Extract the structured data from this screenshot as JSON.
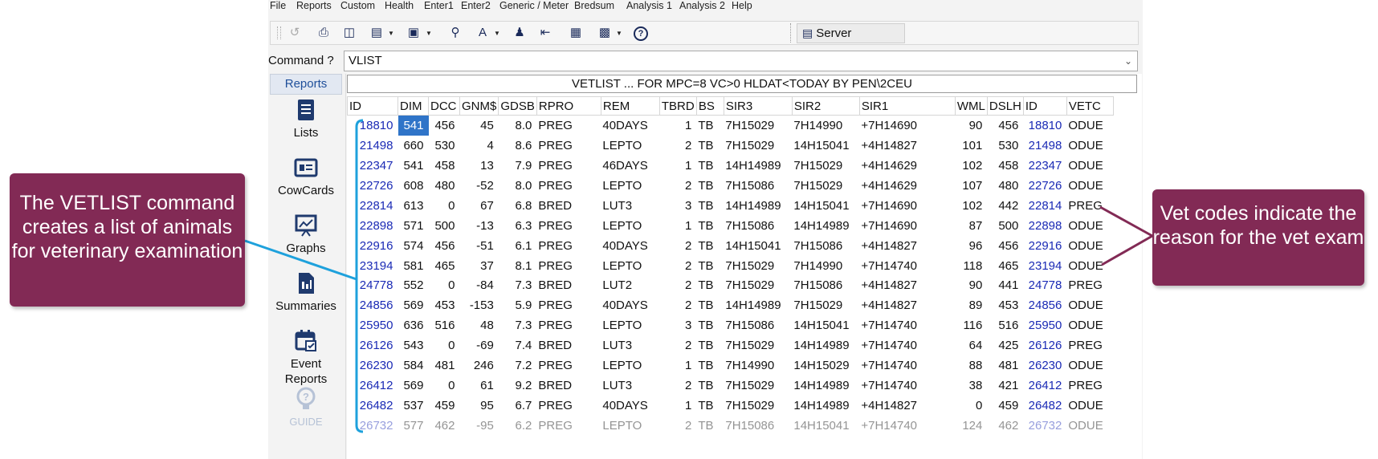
{
  "menu": [
    "File",
    "Reports",
    "Custom",
    "Health",
    "Enter1",
    "Enter2",
    "Generic / Meter",
    "Bredsum",
    "Analysis 1",
    "Analysis 2",
    "Help"
  ],
  "toolbar": {
    "icons": [
      "back-icon",
      "print-icon",
      "print-preview-icon",
      "document-icon",
      "save-icon",
      "search-icon",
      "font-icon",
      "person-icon",
      "export-icon",
      "calendar-icon",
      "card-icon",
      "help-icon"
    ],
    "server_label": "Server"
  },
  "command": {
    "label": "Command ?",
    "value": "VLIST"
  },
  "side_panel": {
    "tab": "Reports",
    "items": [
      {
        "label": "Lists",
        "icon": "list-icon"
      },
      {
        "label": "CowCards",
        "icon": "cowcard-icon"
      },
      {
        "label": "Graphs",
        "icon": "graph-icon"
      },
      {
        "label": "Summaries",
        "icon": "summary-icon"
      },
      {
        "label": "Event\nReports",
        "icon": "event-calendar-icon"
      },
      {
        "label": "GUIDE",
        "icon": "guide-icon"
      }
    ]
  },
  "report": {
    "title": "VETLIST ...  FOR MPC=8 VC>0 HLDAT<TODAY BY PEN\\2CEU",
    "columns": [
      "ID",
      "DIM",
      "DCC",
      "GNM$",
      "GDSB",
      "RPRO",
      "REM",
      "TBRD",
      "BS",
      "SIR3",
      "SIR2",
      "SIR1",
      "WML",
      "DSLH",
      "ID",
      "VETC"
    ],
    "rows": [
      [
        "18810",
        "541",
        "456",
        "45",
        "8.0",
        "PREG",
        "40DAYS",
        "1",
        "TB",
        "7H15029",
        "7H14990",
        "+7H14690",
        "90",
        "456",
        "18810",
        "ODUE"
      ],
      [
        "21498",
        "660",
        "530",
        "4",
        "8.6",
        "PREG",
        "LEPTO",
        "2",
        "TB",
        "7H15029",
        "14H15041",
        "+4H14827",
        "101",
        "530",
        "21498",
        "ODUE"
      ],
      [
        "22347",
        "541",
        "458",
        "13",
        "7.9",
        "PREG",
        "46DAYS",
        "1",
        "TB",
        "14H14989",
        "7H15029",
        "+4H14629",
        "102",
        "458",
        "22347",
        "ODUE"
      ],
      [
        "22726",
        "608",
        "480",
        "-52",
        "8.0",
        "PREG",
        "LEPTO",
        "2",
        "TB",
        "7H15086",
        "7H15029",
        "+4H14629",
        "107",
        "480",
        "22726",
        "ODUE"
      ],
      [
        "22814",
        "613",
        "0",
        "67",
        "6.8",
        "BRED",
        "LUT3",
        "3",
        "TB",
        "14H14989",
        "14H15041",
        "+7H14690",
        "102",
        "442",
        "22814",
        "PREG"
      ],
      [
        "22898",
        "571",
        "500",
        "-13",
        "6.3",
        "PREG",
        "LEPTO",
        "1",
        "TB",
        "7H15086",
        "14H14989",
        "+7H14690",
        "87",
        "500",
        "22898",
        "ODUE"
      ],
      [
        "22916",
        "574",
        "456",
        "-51",
        "6.1",
        "PREG",
        "40DAYS",
        "2",
        "TB",
        "14H15041",
        "7H15086",
        "+4H14827",
        "96",
        "456",
        "22916",
        "ODUE"
      ],
      [
        "23194",
        "581",
        "465",
        "37",
        "8.1",
        "PREG",
        "LEPTO",
        "2",
        "TB",
        "7H15029",
        "7H14990",
        "+7H14740",
        "118",
        "465",
        "23194",
        "ODUE"
      ],
      [
        "24778",
        "552",
        "0",
        "-84",
        "7.3",
        "BRED",
        "LUT2",
        "2",
        "TB",
        "7H15029",
        "7H15086",
        "+4H14827",
        "90",
        "441",
        "24778",
        "PREG"
      ],
      [
        "24856",
        "569",
        "453",
        "-153",
        "5.9",
        "PREG",
        "40DAYS",
        "2",
        "TB",
        "14H14989",
        "7H15029",
        "+4H14827",
        "89",
        "453",
        "24856",
        "ODUE"
      ],
      [
        "25950",
        "636",
        "516",
        "48",
        "7.3",
        "PREG",
        "LEPTO",
        "3",
        "TB",
        "7H15086",
        "14H15041",
        "+7H14740",
        "116",
        "516",
        "25950",
        "ODUE"
      ],
      [
        "26126",
        "543",
        "0",
        "-69",
        "7.4",
        "BRED",
        "LUT3",
        "2",
        "TB",
        "7H15029",
        "14H14989",
        "+7H14740",
        "64",
        "425",
        "26126",
        "PREG"
      ],
      [
        "26230",
        "584",
        "481",
        "246",
        "7.2",
        "PREG",
        "LEPTO",
        "1",
        "TB",
        "7H14990",
        "14H15029",
        "+7H14740",
        "88",
        "481",
        "26230",
        "ODUE"
      ],
      [
        "26412",
        "569",
        "0",
        "61",
        "9.2",
        "BRED",
        "LUT3",
        "2",
        "TB",
        "7H15029",
        "14H14989",
        "+7H14740",
        "38",
        "421",
        "26412",
        "PREG"
      ],
      [
        "26482",
        "537",
        "459",
        "95",
        "6.7",
        "PREG",
        "40DAYS",
        "1",
        "TB",
        "7H15029",
        "14H14989",
        "+4H14827",
        "0",
        "459",
        "26482",
        "ODUE"
      ],
      [
        "26732",
        "577",
        "462",
        "-95",
        "6.2",
        "PREG",
        "LEPTO",
        "2",
        "TB",
        "7H15086",
        "14H15041",
        "+7H14740",
        "124",
        "462",
        "26732",
        "ODUE"
      ]
    ]
  },
  "callouts": {
    "left": "The VETLIST command creates a list of animals for veterinary examination",
    "right": "Vet codes indicate the reason for the vet exam"
  },
  "colors": {
    "callout": "#822a55",
    "bracket": "#1ea1dc",
    "id_link": "#1a2ab5",
    "selection": "#2f74c8"
  }
}
